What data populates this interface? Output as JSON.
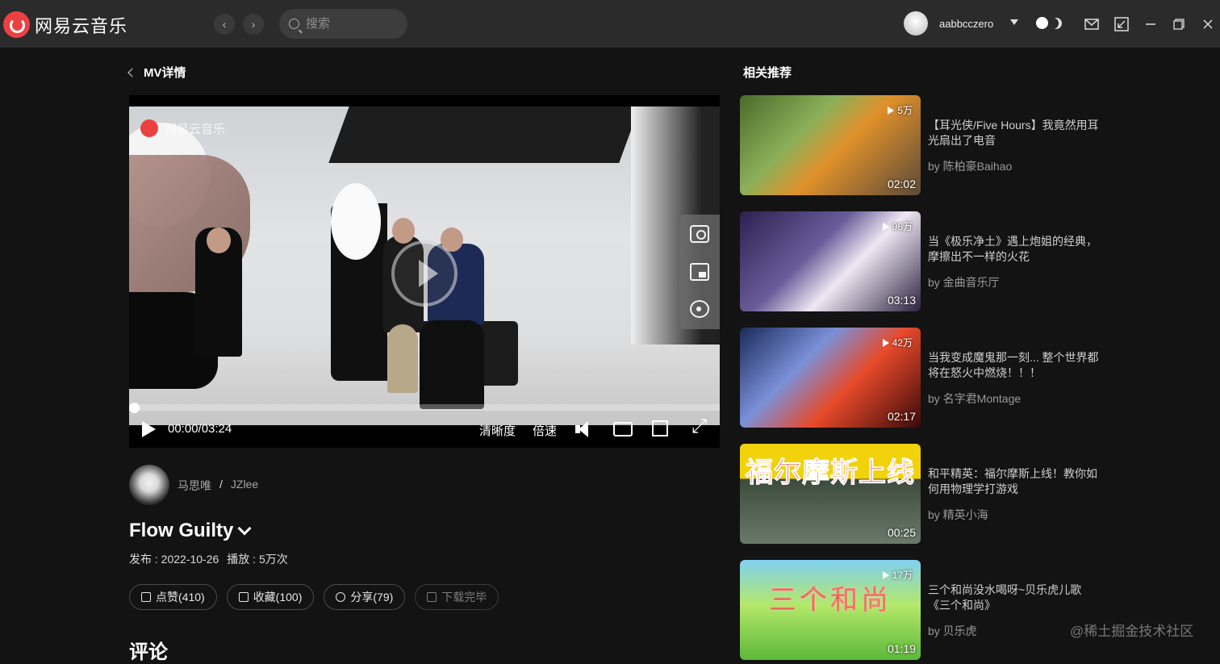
{
  "app": {
    "name": "网易云音乐",
    "search_placeholder": "搜索",
    "username": "aabbcczero"
  },
  "page": {
    "back_label": "MV详情",
    "related_heading": "相关推荐",
    "comments_heading": "评论"
  },
  "player": {
    "watermark": "网易云音乐",
    "time": "00:00/03:24",
    "progress": 0,
    "quality_label": "清晰度",
    "speed_label": "倍速"
  },
  "mv": {
    "artists": [
      "马思唯",
      "JZlee"
    ],
    "artist_separator": "/",
    "title": "Flow Guilty",
    "release": "发布 : 2022-10-26",
    "plays": "播放 : 5万次",
    "actions": {
      "like": "点赞(410)",
      "collect": "收藏(100)",
      "share": "分享(79)",
      "download": "下载完毕"
    }
  },
  "related": [
    {
      "plays": "5万",
      "duration": "02:02",
      "title": "【耳光侠/Five Hours】我竟然用耳光扇出了电音",
      "by": "by 陈柏豪Baihao"
    },
    {
      "plays": "96万",
      "duration": "03:13",
      "title": "当《极乐净土》遇上炮姐的经典，摩擦出不一样的火花",
      "by": "by 金曲音乐厅"
    },
    {
      "plays": "42万",
      "duration": "02:17",
      "title": "当我变成魔鬼那一刻... 整个世界都将在怒火中燃烧！！！",
      "by": "by 名字君Montage"
    },
    {
      "plays": "",
      "duration": "00:25",
      "title": "和平精英：福尔摩斯上线！教你如何用物理学打游戏",
      "by": "by 精英小海",
      "banner": "福尔摩斯上线"
    },
    {
      "plays": "17万",
      "duration": "01:19",
      "title": "三个和尚没水喝呀~贝乐虎儿歌《三个和尚》",
      "by": "by 贝乐虎",
      "banner": "三个和尚"
    }
  ],
  "site_watermark": "@稀土掘金技术社区"
}
